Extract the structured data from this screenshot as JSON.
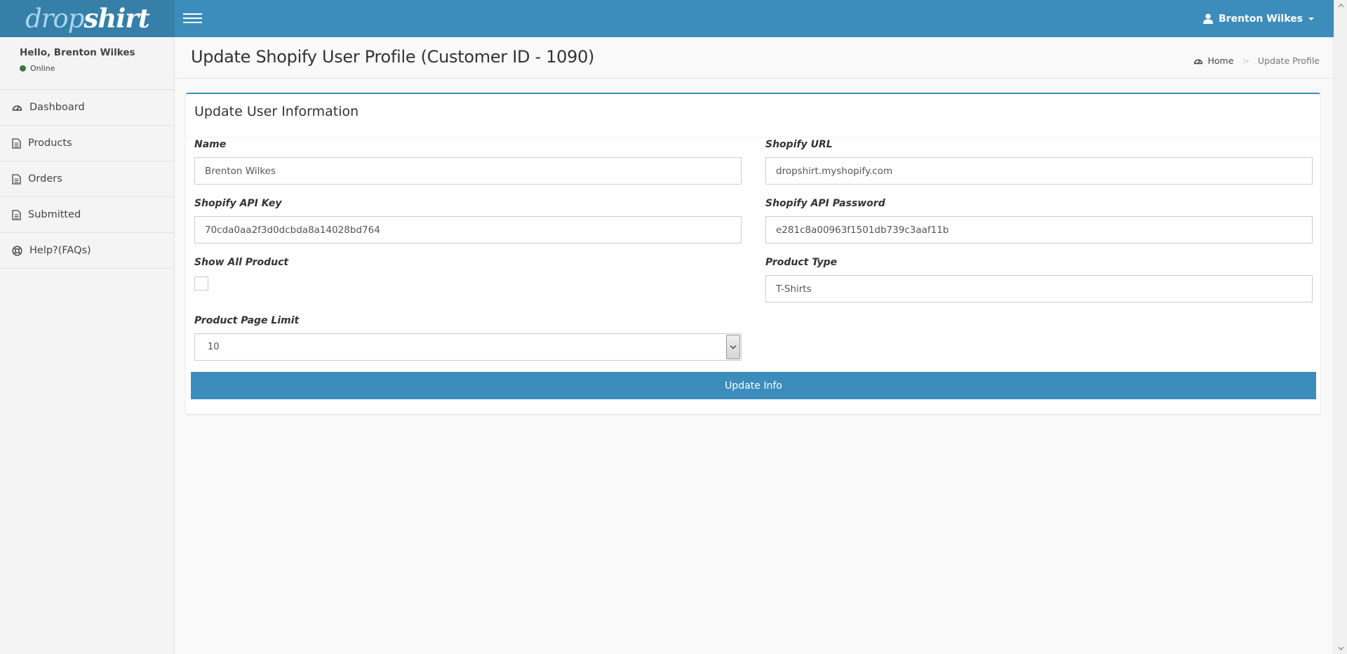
{
  "brand": {
    "logo_part1": "drop",
    "logo_part2": "shirt",
    "accent": "#3c8dbc",
    "logo_bg": "#367fa9"
  },
  "navbar": {
    "menu_toggle_icon": "hamburger-icon",
    "user_name": "Brenton Wilkes",
    "user_icon": "user-icon"
  },
  "sidebar": {
    "greeting": "Hello, Brenton Wilkes",
    "status": "Online",
    "status_color": "#3c763d",
    "items": [
      {
        "label": "Dashboard",
        "icon": "dashboard-icon"
      },
      {
        "label": "Products",
        "icon": "file-icon"
      },
      {
        "label": "Orders",
        "icon": "file-icon"
      },
      {
        "label": "Submitted",
        "icon": "file-icon"
      },
      {
        "label": "Help?(FAQs)",
        "icon": "life-ring-icon"
      }
    ]
  },
  "header": {
    "title": "Update Shopify User Profile (Customer ID - 1090)",
    "breadcrumb": {
      "home": "Home",
      "separator": ">",
      "current": "Update Profile"
    }
  },
  "form": {
    "title": "Update User Information",
    "name": {
      "label": "Name",
      "value": "Brenton Wilkes"
    },
    "shopify_url": {
      "label": "Shopify URL",
      "value": "dropshirt.myshopify.com"
    },
    "api_key": {
      "label": "Shopify API Key",
      "value": "70cda0aa2f3d0dcbda8a14028bd764"
    },
    "api_password": {
      "label": "Shopify API Password",
      "value": "e281c8a00963f1501db739c3aaf11b"
    },
    "show_all_product": {
      "label": "Show All Product",
      "checked": false
    },
    "product_type": {
      "label": "Product Type",
      "value": "T-Shirts"
    },
    "page_limit": {
      "label": "Product Page Limit",
      "value": "10"
    },
    "submit_label": "Update Info"
  }
}
